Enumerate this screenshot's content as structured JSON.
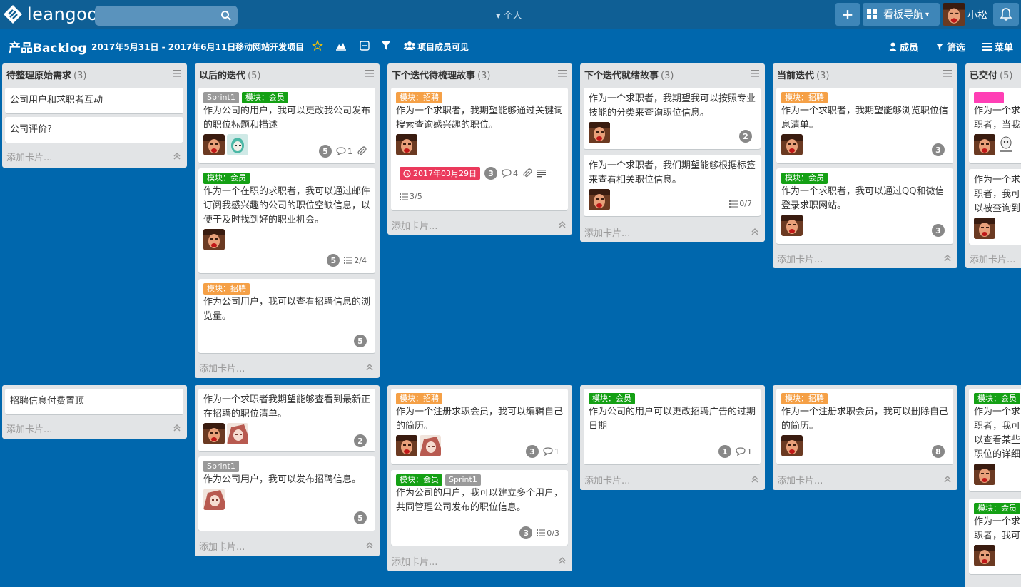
{
  "app": {
    "logo_text": "leangoo",
    "personal": "个人",
    "nav_label": "看板导航",
    "user": "小松"
  },
  "board": {
    "title": "产品Backlog",
    "date_range": "2017年5月31日 - 2017年6月11日",
    "project": "移动网站开发项目",
    "visibility": "项目成员可见",
    "members_label": "成员",
    "filter_label": "筛选",
    "menu_label": "菜单"
  },
  "add_card_label": "添加卡片...",
  "colors": {
    "orange": "#f5a046",
    "green": "#14a014",
    "grey": "#9a9a9a",
    "pink": "#ff3fb5",
    "due": "#eb3a5c"
  },
  "lists": [
    {
      "title": "待整理原始需求",
      "count": "(3)"
    },
    {
      "title": "以后的迭代",
      "count": "(5)"
    },
    {
      "title": "下个迭代待梳理故事",
      "count": "(3)"
    },
    {
      "title": "下个迭代就绪故事",
      "count": "(3)"
    },
    {
      "title": "当前迭代",
      "count": "(3)"
    },
    {
      "title": "已交付",
      "count": "(5)"
    }
  ],
  "cards": {
    "c0a": {
      "text": "公司用户和求职者互动"
    },
    "c0b": {
      "text": "公司评价?"
    },
    "c0c": {
      "text": "招聘信息付费置顶"
    },
    "c1a": {
      "labels": [
        "Sprint1",
        "模块：会员"
      ],
      "text": "作为公司的用户，我可以更改我公司发布的职位标题和描述",
      "points": "5",
      "comments": "1"
    },
    "c1b": {
      "labels": [
        "模块：会员"
      ],
      "text": "作为一个在职的求职者，我可以通过邮件订阅我感兴趣的公司的职位空缺信息，以便于及时找到好的职业机会。",
      "points": "5",
      "checklist": "2/4"
    },
    "c1c": {
      "labels": [
        "模块：招聘"
      ],
      "text": "作为公司用户，我可以查看招聘信息的浏览量。",
      "points": "5"
    },
    "c1d": {
      "text": "作为一个求职者我期望能够查看到最新正在招聘的职位清单。",
      "points": "2"
    },
    "c1e": {
      "labels": [
        "Sprint1"
      ],
      "text": "作为公司用户，我可以发布招聘信息。",
      "points": "5"
    },
    "c2a": {
      "labels": [
        "模块：招聘"
      ],
      "text": "作为一个求职者，我期望能够通过关键词搜索查询感兴趣的职位。",
      "due": "2017年03月29日",
      "points": "3",
      "comments": "4",
      "checklist": "3/5"
    },
    "c2b": {
      "labels": [
        "模块：招聘"
      ],
      "text": "作为一个注册求职会员，我可以编辑自己的简历。",
      "points": "3",
      "comments": "1"
    },
    "c2c": {
      "labels": [
        "模块：会员",
        "Sprint1"
      ],
      "text": "作为公司的用户，我可以建立多个用户，共同管理公司发布的职位信息。",
      "points": "3",
      "checklist": "0/3"
    },
    "c3a": {
      "text": "作为一个求职者，我期望我可以按照专业技能的分类来查询职位信息。",
      "points": "2"
    },
    "c3b": {
      "text": "作为一个求职者，我们期望能够根据标签来查看相关职位信息。",
      "checklist": "0/7"
    },
    "c3c": {
      "labels": [
        "模块：会员"
      ],
      "text": "作为公司的用户可以更改招聘广告的过期日期",
      "points": "1",
      "comments": "1"
    },
    "c4a": {
      "labels": [
        "模块：招聘"
      ],
      "text": "作为一个求职者，我期望能够浏览职位信息清单。",
      "points": "3"
    },
    "c4b": {
      "labels": [
        "模块：会员"
      ],
      "text": "作为一个求职者，我可以通过QQ和微信登录求职网站。",
      "points": "3"
    },
    "c4c": {
      "labels": [
        "模块：招聘"
      ],
      "text": "作为一个注册求职会员，我可以删除自己的简历。",
      "points": "8"
    },
    "c5a": {
      "text": "作为一个求职者，当我忘记密码的时候，"
    },
    "c5b": {
      "text": "作为一个求职者，我可以被查询到简历。"
    },
    "c5c": {
      "labels": [
        "模块：会员"
      ],
      "text": "作为一个求职者，我可以查看某些职位的详细信息，比如薪资水平、地理位置和工"
    },
    "c5d": {
      "labels": [
        "模块：会员"
      ],
      "text": "作为一个求职者，我可以通过邮箱注册一个"
    }
  }
}
